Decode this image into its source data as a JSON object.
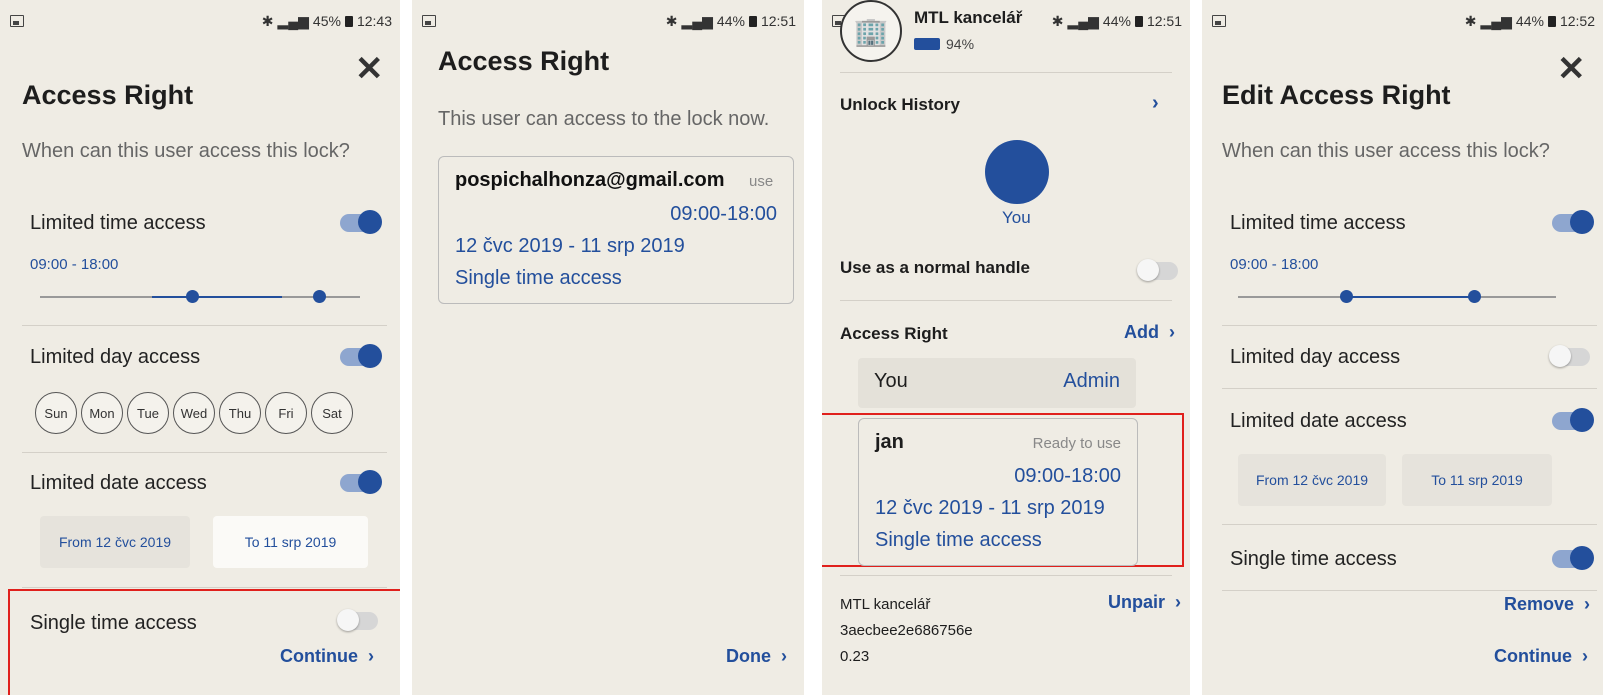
{
  "status": [
    {
      "battery": "45%",
      "time": "12:43"
    },
    {
      "battery": "44%",
      "time": "12:51"
    },
    {
      "battery": "44%",
      "time": "12:51"
    },
    {
      "battery": "44%",
      "time": "12:52"
    }
  ],
  "screen1": {
    "title": "Access Right",
    "subtitle": "When can this user access this lock?",
    "time_label": "Limited time access",
    "time_range": "09:00 - 18:00",
    "day_label": "Limited day access",
    "days": [
      "Sun",
      "Mon",
      "Tue",
      "Wed",
      "Thu",
      "Fri",
      "Sat"
    ],
    "date_label": "Limited date access",
    "date_from": "From 12 čvc 2019",
    "date_to": "To 11 srp 2019",
    "single_label": "Single time access",
    "continue": "Continue"
  },
  "screen2": {
    "title": "Access Right",
    "subtitle": "This user can access to the lock now.",
    "email": "pospichalhonza@gmail.com",
    "status": "use",
    "time": "09:00-18:00",
    "dates": "12 čvc 2019 - 11 srp 2019",
    "type": "Single time access",
    "done": "Done"
  },
  "screen3": {
    "lock_name": "MTL kancelář",
    "battery": "94%",
    "unlock_history": "Unlock History",
    "user_label": "You",
    "handle_label": "Use as a normal handle",
    "access_right": "Access Right",
    "add": "Add",
    "you_label": "You",
    "admin_label": "Admin",
    "card_name": "jan",
    "card_status": "Ready to use",
    "card_time": "09:00-18:00",
    "card_dates": "12 čvc 2019 - 11 srp 2019",
    "card_type": "Single time access",
    "device_name": "MTL kancelář",
    "unpair": "Unpair",
    "device_id": "3aecbee2e686756e",
    "version": "0.23"
  },
  "screen4": {
    "title": "Edit Access Right",
    "subtitle": "When can this user access this lock?",
    "time_label": "Limited time access",
    "time_range": "09:00 - 18:00",
    "day_label": "Limited day access",
    "date_label": "Limited date access",
    "date_from": "From 12 čvc 2019",
    "date_to": "To 11 srp 2019",
    "single_label": "Single time access",
    "remove": "Remove",
    "continue": "Continue"
  },
  "colors": {
    "accent": "#234f9c",
    "highlight": "#e0201c",
    "panel": "#efece4"
  }
}
